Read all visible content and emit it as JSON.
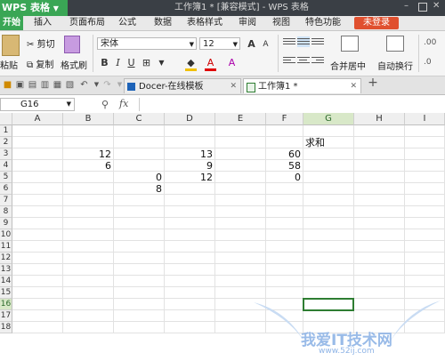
{
  "app": {
    "name": "WPS 表格",
    "title": "工作簿1 * [兼容模式] - WPS 表格"
  },
  "menu": [
    {
      "label": "开始",
      "active": true
    },
    {
      "label": "插入"
    },
    {
      "label": "页面布局"
    },
    {
      "label": "公式"
    },
    {
      "label": "数据"
    },
    {
      "label": "表格样式"
    },
    {
      "label": "审阅"
    },
    {
      "label": "视图"
    },
    {
      "label": "特色功能"
    }
  ],
  "login_label": "未登录",
  "ribbon": {
    "paste": "粘贴",
    "cut": "剪切",
    "copy": "复制",
    "format_painter": "格式刷",
    "font_name": "宋体",
    "font_size": "12",
    "merge_center": "合并居中",
    "auto_wrap": "自动换行",
    "bold": "B",
    "italic": "I",
    "underline": "U"
  },
  "tabs": [
    {
      "label": "Docer-在线模板"
    },
    {
      "label": "工作簿1 *",
      "active": true
    }
  ],
  "formula_bar": {
    "cell_ref": "G16",
    "fx": "fx",
    "formula": ""
  },
  "columns": [
    "A",
    "B",
    "C",
    "D",
    "E",
    "F",
    "G",
    "H",
    "I"
  ],
  "rows": [
    "1",
    "2",
    "3",
    "4",
    "5",
    "6",
    "7",
    "8",
    "9",
    "10",
    "11",
    "12",
    "13",
    "14",
    "15",
    "16",
    "17",
    "18"
  ],
  "cells": {
    "G2": "求和",
    "B3": "12",
    "D3": "13",
    "F3": "60",
    "B4": "6",
    "D4": "9",
    "F4": "58",
    "C5": "0",
    "D5": "12",
    "F5": "0",
    "C6": "8"
  },
  "selected_cell": "G16",
  "watermark": {
    "text": "我爱IT技术网",
    "url": "www.52ij.com"
  }
}
